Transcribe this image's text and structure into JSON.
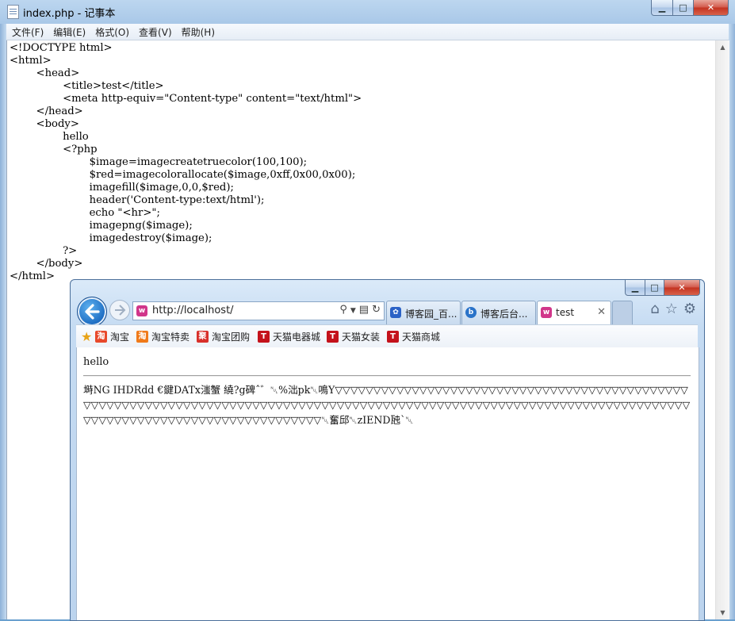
{
  "notepad": {
    "title": "index.php - 记事本",
    "menu": [
      "文件(F)",
      "编辑(E)",
      "格式(O)",
      "查看(V)",
      "帮助(H)"
    ],
    "content": "<!DOCTYPE html>\n<html>\n\t<head>\n\t\t<title>test</title>\n\t\t<meta http-equiv=\"Content-type\" content=\"text/html\">\n\t</head>\n\t<body>\n\t\thello\n\t\t<?php\n\t\t\t$image=imagecreatetruecolor(100,100);\n\t\t\t$red=imagecolorallocate($image,0xff,0x00,0x00);\n\t\t\timagefill($image,0,0,$red);\n\t\t\theader('Content-type:text/html');\n\t\t\techo \"<hr>\";\n\t\t\timagepng($image);\n\t\t\timagedestroy($image);\n\t\t?>\n\t</body>\n</html>"
  },
  "browser": {
    "address": "http://localhost/",
    "tabs": [
      {
        "label": "博客园_百...",
        "icon": "paw-icon"
      },
      {
        "label": "博客后台...",
        "icon": "blog-icon"
      },
      {
        "label": "test",
        "icon": "localhost-icon"
      }
    ],
    "favorites": [
      {
        "label": "淘宝",
        "icon": "淘",
        "color": "#e8492b"
      },
      {
        "label": "淘宝特卖",
        "icon": "淘",
        "color": "#f07a1a"
      },
      {
        "label": "淘宝团购",
        "icon": "聚",
        "color": "#d8302a"
      },
      {
        "label": "天猫电器城",
        "icon": "T",
        "color": "#c4121b"
      },
      {
        "label": "天猫女装",
        "icon": "T",
        "color": "#c4121b"
      },
      {
        "label": "天猫商城",
        "icon": "T",
        "color": "#c4121b"
      }
    ],
    "page": {
      "hello": "hello",
      "garbage": "塒NG  IHDRdd  €鍵DATx滍蟹 繞?g碑ˆ゛␀%泏pk␀鳴Y▽▽▽▽▽▽▽▽▽▽▽▽▽▽▽▽▽▽▽▽▽▽▽▽▽▽▽▽▽▽▽▽▽▽▽▽▽▽▽▽▽▽▽▽▽▽▽▽▽▽▽▽▽▽▽▽▽▽▽▽▽▽▽▽▽▽▽▽▽▽▽▽▽▽▽▽▽▽▽▽▽▽▽▽▽▽▽▽▽▽▽▽▽▽▽▽▽▽▽▽▽▽▽▽▽▽▽▽▽▽▽▽▽▽▽▽▽▽▽▽▽▽▽▽▽▽▽▽▽▽▽▽▽▽▽▽▽▽▽▽▽▽▽▽▽▽▽▽▽▽▽▽▽▽▽▽␀奮邱␀zIEND瓲`␀"
    }
  }
}
